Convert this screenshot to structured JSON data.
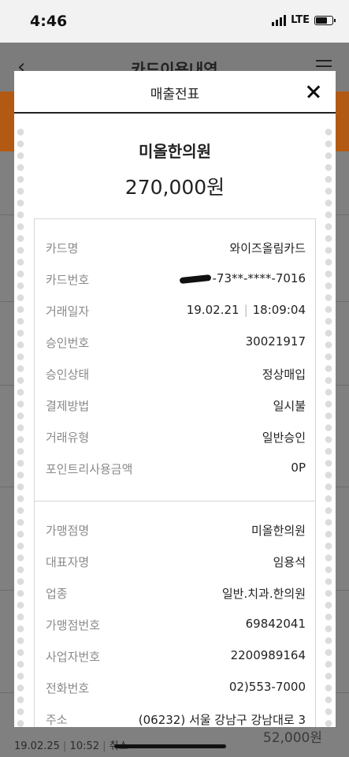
{
  "status_bar": {
    "time": "4:46",
    "network": "LTE"
  },
  "background": {
    "title": "카드이용내역",
    "last_row": {
      "date": "19.02.25",
      "time": "10:52",
      "status": "취소",
      "amount": "52,000원"
    }
  },
  "modal": {
    "title": "매출전표",
    "merchant": "미올한의원",
    "amount": "270,000원",
    "transaction": [
      {
        "label": "카드명",
        "value": "와이즈올림카드"
      },
      {
        "label": "카드번호",
        "value": "73**-****-7016"
      },
      {
        "label": "거래일자",
        "date": "19.02.21",
        "time": "18:09:04"
      },
      {
        "label": "승인번호",
        "value": "30021917"
      },
      {
        "label": "승인상태",
        "value": "정상매입"
      },
      {
        "label": "결제방법",
        "value": "일시불"
      },
      {
        "label": "거래유형",
        "value": "일반승인"
      },
      {
        "label": "포인트리사용금액",
        "value": "0P"
      }
    ],
    "merchant_info": [
      {
        "label": "가맹점명",
        "value": "미올한의원"
      },
      {
        "label": "대표자명",
        "value": "임용석"
      },
      {
        "label": "업종",
        "value": "일반.치과.한의원"
      },
      {
        "label": "가맹점번호",
        "value": "69842041"
      },
      {
        "label": "사업자번호",
        "value": "2200989164"
      },
      {
        "label": "전화번호",
        "value": "02)553-7000"
      },
      {
        "label": "주소",
        "value": "(06232) 서울 강남구 강남대로 3"
      }
    ]
  }
}
